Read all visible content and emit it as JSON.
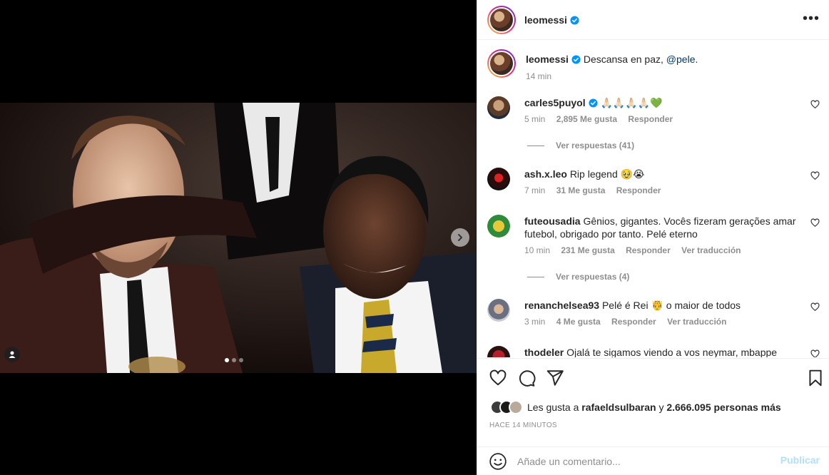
{
  "post": {
    "username": "leomessi",
    "caption_text": "Descansa en paz,",
    "caption_mention": "@pele",
    "caption_end": ".",
    "caption_time": "14 min",
    "more_label": "•••"
  },
  "media": {
    "carousel_total": 3,
    "carousel_active": 1
  },
  "comments": [
    {
      "username": "carles5puyol",
      "verified": true,
      "text": "🙏🏻🙏🏻🙏🏻🙏🏻💚",
      "time": "5 min",
      "likes": "2,895 Me gusta",
      "reply": "Responder",
      "translate": "",
      "replies": "Ver respuestas (41)"
    },
    {
      "username": "ash.x.leo",
      "verified": false,
      "text": "Rip legend 🥹😭",
      "time": "7 min",
      "likes": "31 Me gusta",
      "reply": "Responder",
      "translate": "",
      "replies": ""
    },
    {
      "username": "futeousadia",
      "verified": false,
      "text": "Gênios, gigantes. Vocês fizeram gerações amar futebol, obrigado por tanto. Pelé eterno",
      "time": "10 min",
      "likes": "231 Me gusta",
      "reply": "Responder",
      "translate": "Ver traducción",
      "replies": "Ver respuestas (4)"
    },
    {
      "username": "renanchelsea93",
      "verified": false,
      "text": "Pelé é Rei 🤴 o maior de todos",
      "time": "3 min",
      "likes": "4 Me gusta",
      "reply": "Responder",
      "translate": "Ver traducción",
      "replies": ""
    },
    {
      "username": "thodeler",
      "verified": false,
      "text": "Ojalá te sigamos viendo a vos neymar, mbappe",
      "time": "",
      "likes": "",
      "reply": "",
      "translate": "",
      "replies": ""
    }
  ],
  "likes": {
    "prefix": "Les gusta a",
    "user": "rafaeldsulbaran",
    "connector": "y",
    "others": "2.666.095 personas más"
  },
  "time_ago": "HACE 14 MINUTOS",
  "add_comment": {
    "placeholder": "Añade un comentario...",
    "post_label": "Publicar"
  },
  "colors": {
    "verified": "#0095f6",
    "link": "#00376b",
    "muted": "#8e8e8e",
    "post_disabled": "#b2dffc"
  }
}
